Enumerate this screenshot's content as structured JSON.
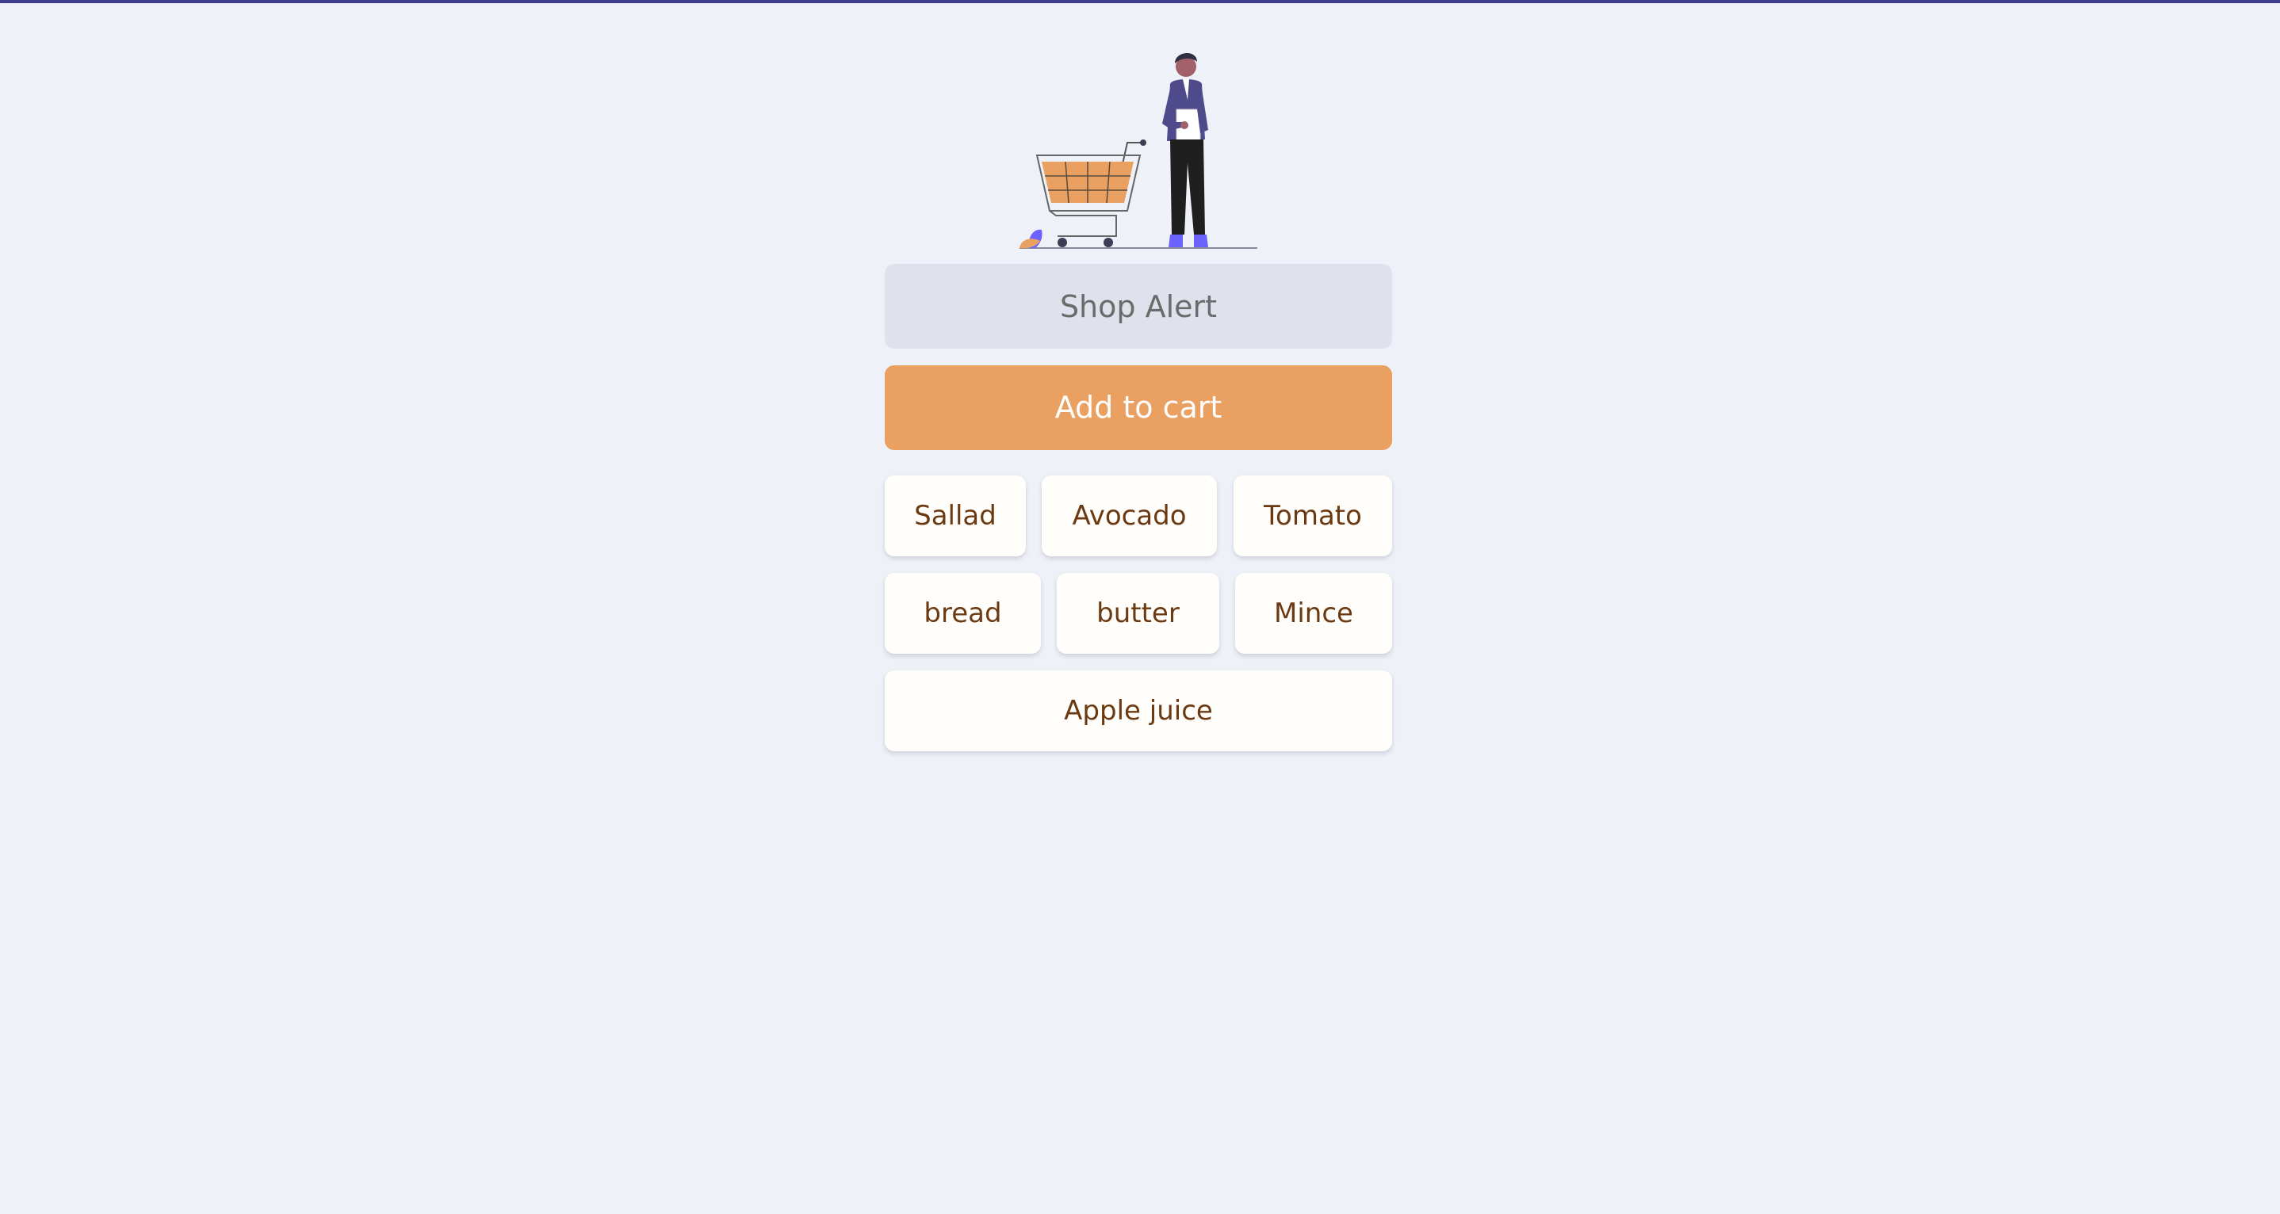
{
  "app": {
    "accent_color": "#3f3d8f",
    "background_color": "#eef1f7"
  },
  "hero": {
    "illustration": "shopping-person-with-cart-illustration"
  },
  "form": {
    "input_placeholder": "Shop Alert",
    "input_value": "",
    "add_button_label": "Add to cart",
    "add_button_color": "#e9a060"
  },
  "cart": {
    "items": [
      {
        "label": "Sallad"
      },
      {
        "label": "Avocado"
      },
      {
        "label": "Tomato"
      },
      {
        "label": "bread"
      },
      {
        "label": "butter"
      },
      {
        "label": "Mince"
      },
      {
        "label": "Apple juice"
      }
    ],
    "item_text_color": "#6b3a12"
  }
}
